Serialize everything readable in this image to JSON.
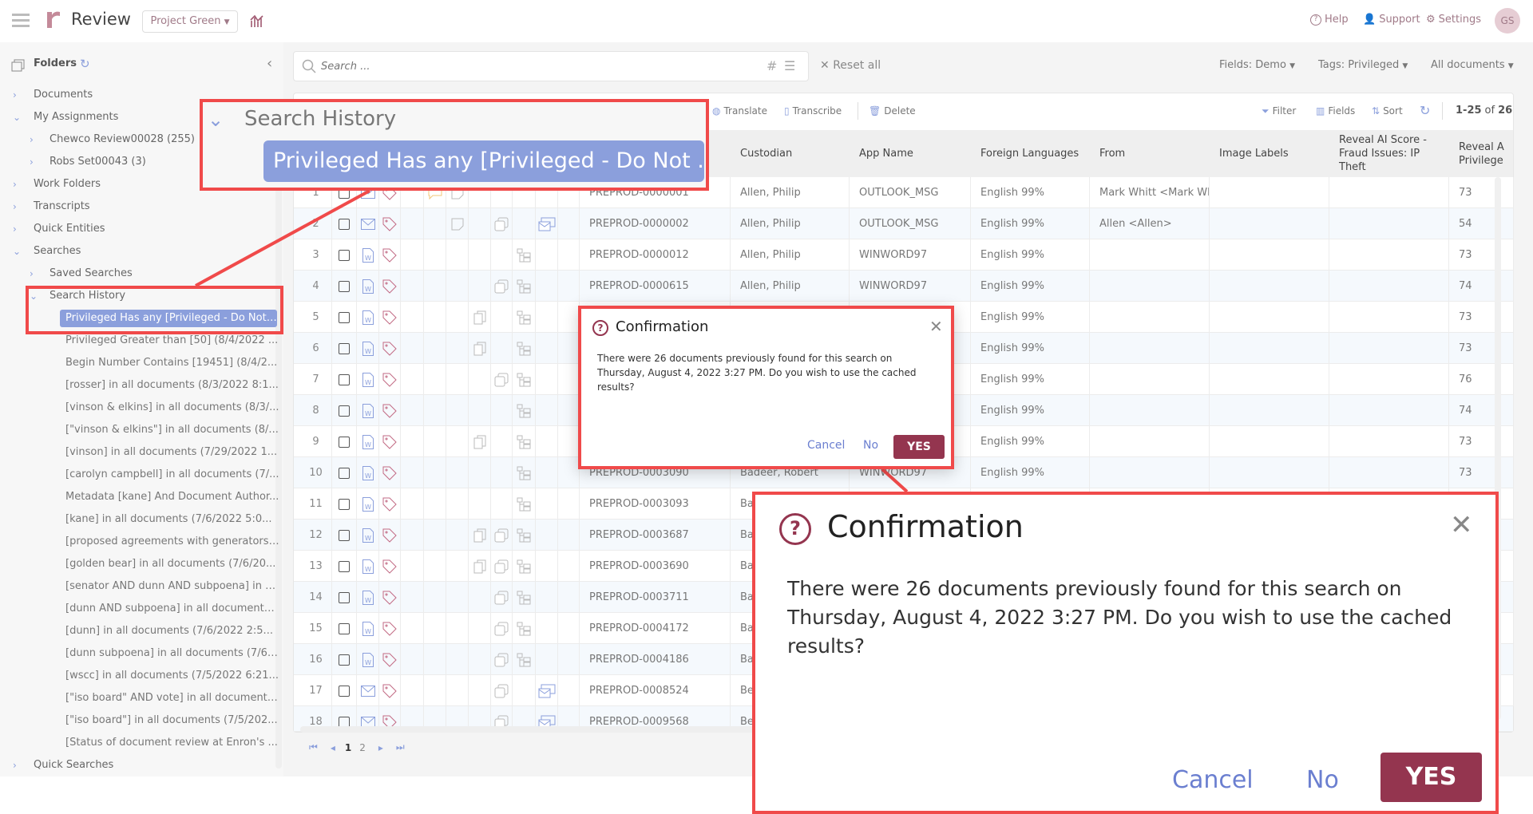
{
  "app": {
    "title": "Review",
    "project": "Project Green"
  },
  "header": {
    "help": "Help",
    "support": "Support",
    "settings": "Settings",
    "avatar": "GS"
  },
  "colors": {
    "brand": "#94354f",
    "accent": "#8b9fdc",
    "callout": "#f04a4a"
  },
  "sidebar": {
    "title": "Folders",
    "items": [
      {
        "label": "Documents"
      },
      {
        "label": "My Assignments"
      },
      {
        "label": "Chewco Review00028 (255)"
      },
      {
        "label": "Robs Set00043 (3)"
      },
      {
        "label": "Work Folders"
      },
      {
        "label": "Transcripts"
      },
      {
        "label": "Quick Entities"
      },
      {
        "label": "Searches"
      },
      {
        "label": "Saved Searches"
      },
      {
        "label": "Search History"
      },
      {
        "label": "Quick Searches"
      }
    ],
    "history": [
      "Privileged Has any [Privileged - Do Not ...",
      "Privileged Greater than [50] (8/4/2022 ...",
      "Begin Number Contains [19451] (8/4/2...",
      "[rosser] in all documents (8/3/2022 8:1...",
      "[vinson & elkins] in all documents (8/3/...",
      "[\"vinson & elkins\"] in all documents (8/...",
      "[vinson] in all documents (7/29/2022 1...",
      "[carolyn campbell] in all documents (7/...",
      "Metadata [kane] And Document Author...",
      "[kane] in all documents (7/6/2022 5:0...",
      "[proposed agreements with generators]...",
      "[golden bear] in all documents (7/6/20...",
      "[senator AND dunn AND subpoena] in a...",
      "[dunn AND subpoena] in all documents ...",
      "[dunn] in all documents (7/6/2022 2:5...",
      "[dunn subpoena] in all documents (7/6/...",
      "[wscc] in all documents (7/5/2022 6:21...",
      "[\"iso board\" AND vote] in all documents...",
      "[\"iso board\"] in all documents (7/5/202...",
      "[Status of document review at Enron's ..."
    ]
  },
  "search": {
    "placeholder": "Search ...",
    "reset": "Reset all",
    "fields": "Fields: Demo",
    "tags": "Tags: Privileged",
    "scope": "All documents"
  },
  "toolbar": {
    "translate": "Translate",
    "transcribe": "Transcribe",
    "delete": "Delete",
    "filter": "Filter",
    "fields": "Fields",
    "sort": "Sort",
    "range": "1-25",
    "of": "of",
    "total": "26"
  },
  "table": {
    "columns": [
      "Custodian",
      "App Name",
      "Foreign Languages",
      "From",
      "Image Labels",
      "Reveal AI Score - Fraud Issues: IP Theft",
      "Reveal A Privilege"
    ],
    "rows": [
      {
        "n": "1",
        "type": "email",
        "icons": [
          "comment",
          "note"
        ],
        "id": "PREPROD-0000001",
        "custodian": "Allen, Philip",
        "app": "OUTLOOK_MSG",
        "lang": "English 99%",
        "from": "Mark Whitt <Mark Wh",
        "score": "73"
      },
      {
        "n": "2",
        "type": "email",
        "icons": [
          "note",
          "duplicate",
          "email-family"
        ],
        "id": "PREPROD-0000002",
        "custodian": "Allen, Philip",
        "app": "OUTLOOK_MSG",
        "lang": "English 99%",
        "from": "Allen <Allen>",
        "score": "54"
      },
      {
        "n": "3",
        "type": "word",
        "icons": [
          "family-tree"
        ],
        "id": "PREPROD-0000012",
        "custodian": "Allen, Philip",
        "app": "WINWORD97",
        "lang": "English 99%",
        "from": "",
        "score": "73"
      },
      {
        "n": "4",
        "type": "word",
        "icons": [
          "duplicate",
          "family-tree"
        ],
        "id": "PREPROD-0000615",
        "custodian": "Allen, Philip",
        "app": "WINWORD97",
        "lang": "English 99%",
        "from": "",
        "score": "74"
      },
      {
        "n": "5",
        "type": "word",
        "icons": [
          "near-duplicate",
          "family-tree"
        ],
        "id": "",
        "custodian": "",
        "app": "",
        "lang": "English 99%",
        "from": "",
        "score": "73"
      },
      {
        "n": "6",
        "type": "word",
        "icons": [
          "near-duplicate",
          "family-tree"
        ],
        "id": "",
        "custodian": "",
        "app": "",
        "lang": "English 99%",
        "from": "",
        "score": "73"
      },
      {
        "n": "7",
        "type": "word",
        "icons": [
          "duplicate",
          "family-tree"
        ],
        "id": "",
        "custodian": "",
        "app": "",
        "lang": "English 99%",
        "from": "",
        "score": "76"
      },
      {
        "n": "8",
        "type": "word",
        "icons": [
          "family-tree"
        ],
        "id": "",
        "custodian": "",
        "app": "",
        "lang": "English 99%",
        "from": "",
        "score": "74"
      },
      {
        "n": "9",
        "type": "word",
        "icons": [
          "near-duplicate",
          "family-tree"
        ],
        "id": "",
        "custodian": "",
        "app": "",
        "lang": "English 99%",
        "from": "",
        "score": "73"
      },
      {
        "n": "10",
        "type": "word",
        "icons": [
          "family-tree"
        ],
        "id": "PREPROD-0003090",
        "custodian": "Badeer, Robert",
        "app": "WINWORD97",
        "lang": "English 99%",
        "from": "",
        "score": "73"
      },
      {
        "n": "11",
        "type": "word",
        "icons": [
          "family-tree"
        ],
        "id": "PREPROD-0003093",
        "custodian": "Ba",
        "app": "",
        "lang": "",
        "from": "",
        "score": ""
      },
      {
        "n": "12",
        "type": "word",
        "icons": [
          "near-duplicate",
          "duplicate",
          "family-tree"
        ],
        "id": "PREPROD-0003687",
        "custodian": "Ba",
        "app": "",
        "lang": "",
        "from": "",
        "score": ""
      },
      {
        "n": "13",
        "type": "word",
        "icons": [
          "near-duplicate",
          "duplicate",
          "family-tree"
        ],
        "id": "PREPROD-0003690",
        "custodian": "Ba",
        "app": "",
        "lang": "",
        "from": "",
        "score": ""
      },
      {
        "n": "14",
        "type": "word",
        "icons": [
          "duplicate",
          "family-tree"
        ],
        "id": "PREPROD-0003711",
        "custodian": "Ba",
        "app": "",
        "lang": "",
        "from": "",
        "score": ""
      },
      {
        "n": "15",
        "type": "word",
        "icons": [
          "duplicate",
          "family-tree"
        ],
        "id": "PREPROD-0004172",
        "custodian": "Ba",
        "app": "",
        "lang": "",
        "from": "",
        "score": ""
      },
      {
        "n": "16",
        "type": "word",
        "icons": [
          "duplicate",
          "family-tree"
        ],
        "id": "PREPROD-0004186",
        "custodian": "Ba",
        "app": "",
        "lang": "",
        "from": "",
        "score": ""
      },
      {
        "n": "17",
        "type": "email",
        "icons": [
          "duplicate",
          "email-family"
        ],
        "id": "PREPROD-0008524",
        "custodian": "Be",
        "app": "",
        "lang": "",
        "from": "",
        "score": ""
      },
      {
        "n": "18",
        "type": "email",
        "icons": [
          "duplicate",
          "email-family"
        ],
        "id": "PREPROD-0009568",
        "custodian": "Be",
        "app": "",
        "lang": "",
        "from": "",
        "score": ""
      }
    ]
  },
  "pagination": {
    "pages": [
      "1",
      "2"
    ],
    "current": "1"
  },
  "callout": {
    "heading": "Search History",
    "item": "Privileged Has any [Privileged - Do Not ..."
  },
  "dialog": {
    "title": "Confirmation",
    "message": "There were 26 documents previously found for this search on Thursday, August 4, 2022 3:27 PM. Do you wish to use the cached results?",
    "cancel": "Cancel",
    "no": "No",
    "yes": "YES"
  }
}
